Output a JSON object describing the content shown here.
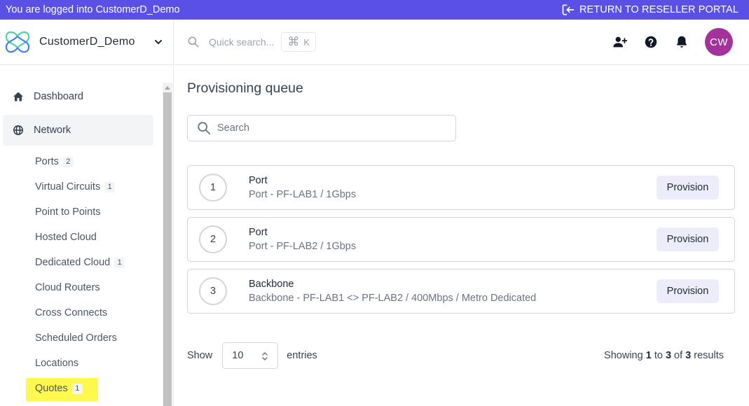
{
  "banner": {
    "logged_in_text": "You are logged into CustomerD_Demo",
    "return_label": "RETURN TO RESELLER PORTAL"
  },
  "header": {
    "org_name": "CustomerD_Demo",
    "search_placeholder": "Quick search...",
    "shortcut_symbol": "⌘",
    "shortcut_key": "K",
    "avatar_initials": "CW"
  },
  "colors": {
    "banner": "#5b50e6",
    "avatar": "#a3329b",
    "highlight": "#fff94d",
    "provision_button": "#edecfb"
  },
  "sidebar": {
    "top_items": [
      {
        "label": "Dashboard",
        "icon": "home-icon"
      },
      {
        "label": "Network",
        "icon": "globe-icon",
        "active": true
      }
    ],
    "network_items": [
      {
        "label": "Ports",
        "badge": "2"
      },
      {
        "label": "Virtual Circuits",
        "badge": "1"
      },
      {
        "label": "Point to Points"
      },
      {
        "label": "Hosted Cloud"
      },
      {
        "label": "Dedicated Cloud",
        "badge": "1"
      },
      {
        "label": "Cloud Routers"
      },
      {
        "label": "Cross Connects"
      },
      {
        "label": "Scheduled Orders"
      },
      {
        "label": "Locations"
      },
      {
        "label": "Quotes",
        "badge": "1",
        "highlighted": true
      }
    ]
  },
  "main": {
    "title": "Provisioning queue",
    "search_placeholder": "Search",
    "queue": [
      {
        "number": "1",
        "name": "Port",
        "description": "Port - PF-LAB1 / 1Gbps",
        "action": "Provision"
      },
      {
        "number": "2",
        "name": "Port",
        "description": "Port - PF-LAB2 / 1Gbps",
        "action": "Provision"
      },
      {
        "number": "3",
        "name": "Backbone",
        "description": "Backbone - PF-LAB1 <> PF-LAB2 / 400Mbps / Metro Dedicated",
        "action": "Provision"
      }
    ],
    "pagination": {
      "show_label": "Show",
      "entries_value": "10",
      "entries_label": "entries",
      "showing_prefix": "Showing",
      "from": "1",
      "to_word": "to",
      "to": "3",
      "of_word": "of",
      "total": "3",
      "results_word": "results"
    }
  }
}
